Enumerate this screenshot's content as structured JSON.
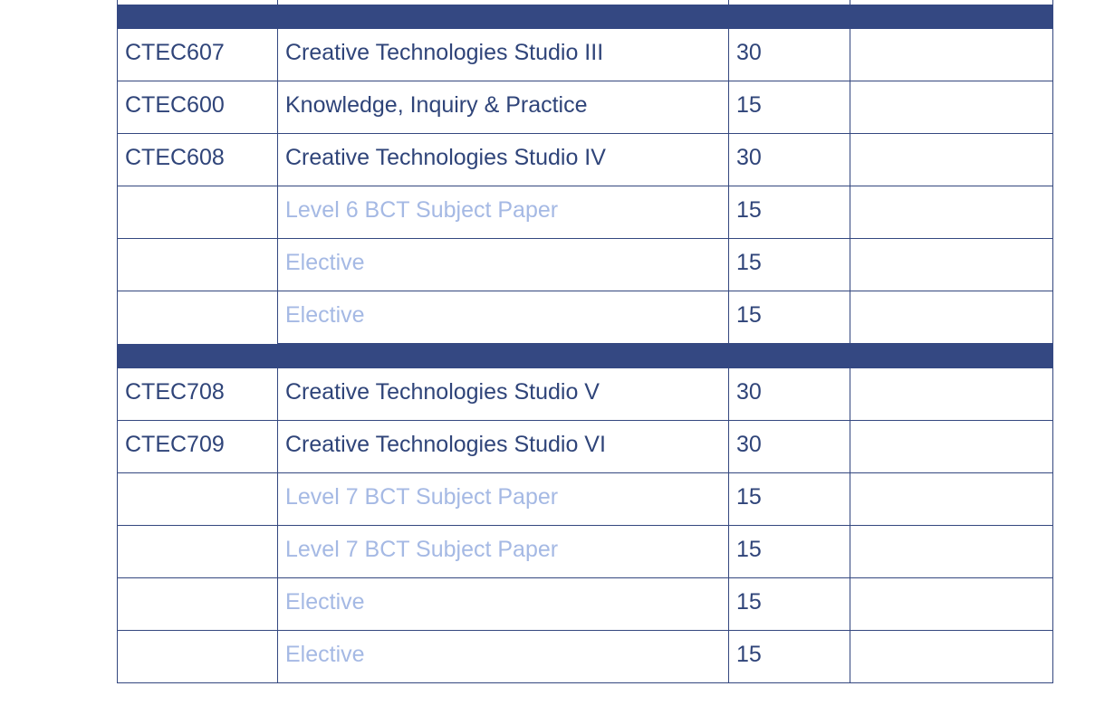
{
  "colors": {
    "band": "#344882",
    "border": "#34477f",
    "text": "#2f4479",
    "placeholder_text": "#a5b9e4"
  },
  "groups": [
    {
      "rows": [
        {
          "code": "CTEC607",
          "title": "Creative Technologies Studio III",
          "credits": "30",
          "placeholder": false
        },
        {
          "code": "CTEC600",
          "title": "Knowledge, Inquiry & Practice",
          "credits": "15",
          "placeholder": false
        },
        {
          "code": "CTEC608",
          "title": "Creative Technologies Studio IV",
          "credits": "30",
          "placeholder": false
        },
        {
          "code": "",
          "title": "Level 6 BCT Subject Paper",
          "credits": "15",
          "placeholder": true
        },
        {
          "code": "",
          "title": "Elective",
          "credits": "15",
          "placeholder": true
        },
        {
          "code": "",
          "title": "Elective",
          "credits": "15",
          "placeholder": true
        }
      ]
    },
    {
      "rows": [
        {
          "code": "CTEC708",
          "title": "Creative Technologies Studio V",
          "credits": "30",
          "placeholder": false
        },
        {
          "code": "CTEC709",
          "title": "Creative Technologies Studio VI",
          "credits": "30",
          "placeholder": false
        },
        {
          "code": "",
          "title": "Level 7 BCT Subject Paper",
          "credits": "15",
          "placeholder": true
        },
        {
          "code": "",
          "title": "Level 7 BCT Subject Paper",
          "credits": "15",
          "placeholder": true
        },
        {
          "code": "",
          "title": "Elective",
          "credits": "15",
          "placeholder": true
        },
        {
          "code": "",
          "title": "Elective",
          "credits": "15",
          "placeholder": true
        }
      ]
    }
  ]
}
